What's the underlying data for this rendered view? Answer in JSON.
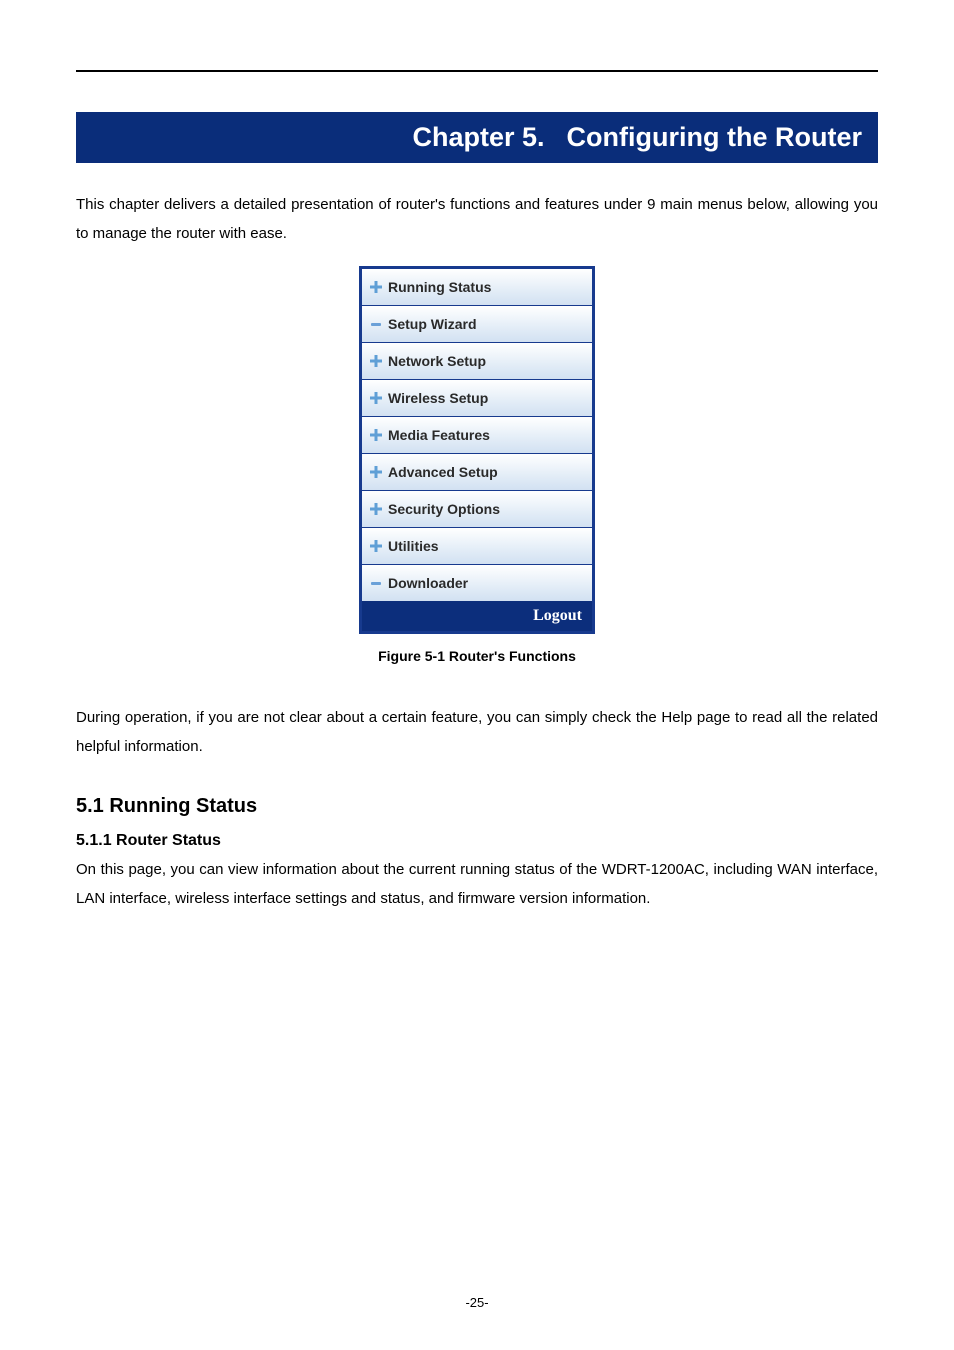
{
  "chapter": {
    "label_left": "Chapter 5.",
    "label_right": "Configuring the Router"
  },
  "intro_paragraph": "This chapter delivers a detailed presentation of router's functions and features under 9 main menus below, allowing you to manage the router with ease.",
  "menu": {
    "items": [
      {
        "icon": "plus",
        "label": "Running Status"
      },
      {
        "icon": "dash",
        "label": "Setup Wizard"
      },
      {
        "icon": "plus",
        "label": "Network Setup"
      },
      {
        "icon": "plus",
        "label": "Wireless Setup"
      },
      {
        "icon": "plus",
        "label": "Media Features"
      },
      {
        "icon": "plus",
        "label": "Advanced Setup"
      },
      {
        "icon": "plus",
        "label": "Security Options"
      },
      {
        "icon": "plus",
        "label": "Utilities"
      },
      {
        "icon": "dash",
        "label": "Downloader"
      }
    ],
    "logout_label": "Logout"
  },
  "figure_caption": "Figure 5-1 Router's Functions",
  "help_paragraph": "During operation, if you are not clear about a certain feature, you can simply check the Help page to read all the related helpful information.",
  "section": {
    "h2": "5.1  Running Status",
    "h3": "5.1.1  Router Status",
    "para": "On this page, you can view information about the current running status of the WDRT-1200AC, including WAN interface, LAN interface, wireless interface settings and status, and firmware version information."
  },
  "page_number": "-25-"
}
